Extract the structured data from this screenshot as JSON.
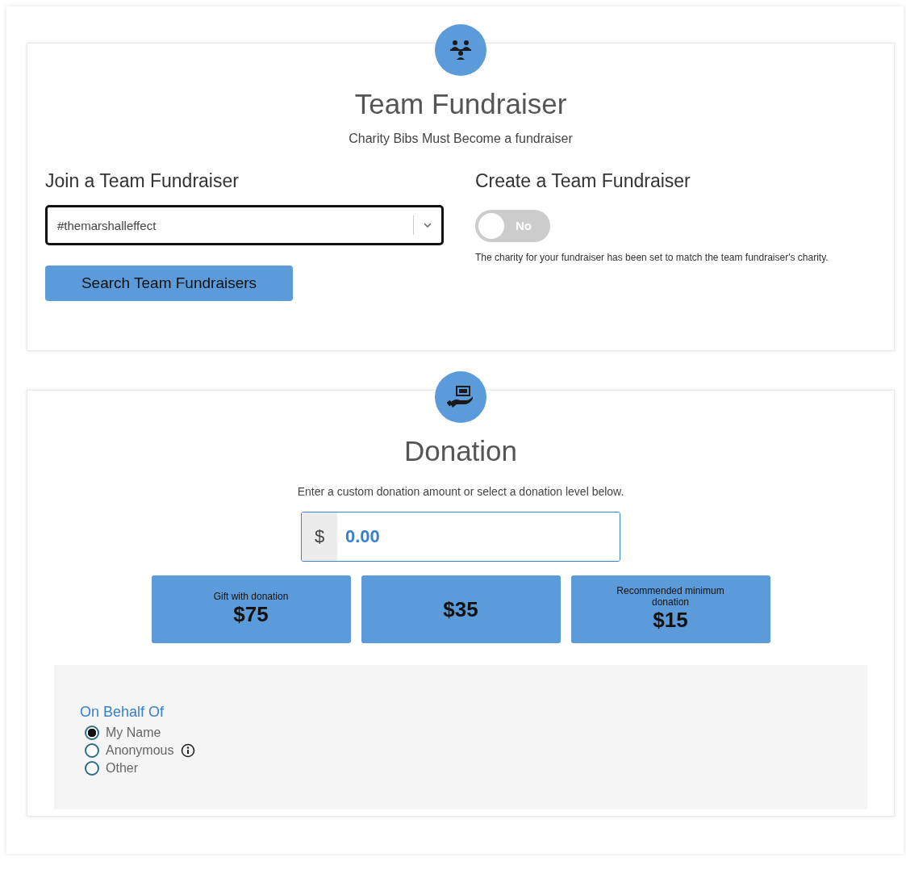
{
  "team": {
    "title": "Team Fundraiser",
    "subtitle": "Charity Bibs Must Become a fundraiser",
    "join": {
      "heading": "Join a Team Fundraiser",
      "value": "#themarshalleffect",
      "button": "Search Team Fundraisers"
    },
    "create": {
      "heading": "Create a Team Fundraiser",
      "toggle": {
        "label": "No",
        "on": false
      },
      "note": "The charity for your fundraiser has been set to match the team fundraiser's charity."
    }
  },
  "donation": {
    "title": "Donation",
    "instructions": "Enter a custom donation amount or select a donation level below.",
    "currency": "$",
    "amount": "0.00",
    "levels": [
      {
        "caption": "Gift with donation",
        "amount": "$75"
      },
      {
        "amount": "$35"
      },
      {
        "caption": "Recommended minimum donation",
        "amount": "$15"
      }
    ],
    "on_behalf": {
      "label": "On Behalf Of",
      "options": [
        {
          "label": "My Name",
          "selected": true,
          "kind": "plain"
        },
        {
          "label": "Anonymous",
          "selected": false,
          "kind": "with_info"
        },
        {
          "label": "Other",
          "selected": false,
          "kind": "plain"
        }
      ]
    }
  }
}
